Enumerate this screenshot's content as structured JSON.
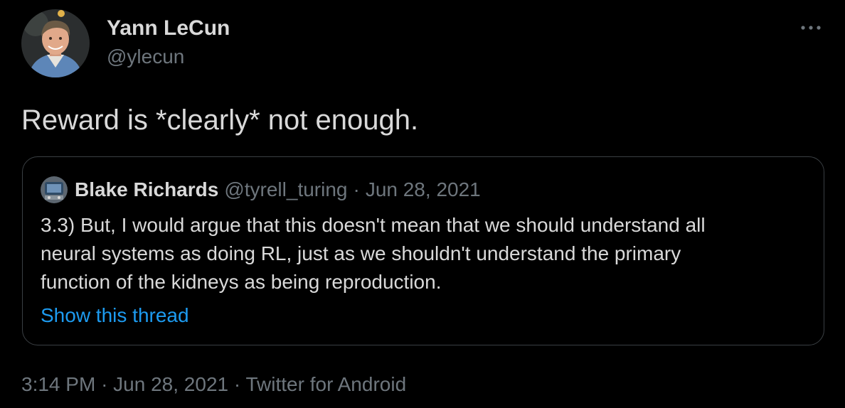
{
  "author": {
    "name": "Yann LeCun",
    "handle": "@ylecun",
    "avatar_icon": "profile-photo-icon"
  },
  "more_icon": "ellipsis-icon",
  "tweet": {
    "text": "Reward is *clearly* not enough."
  },
  "quoted_tweet": {
    "author_name": "Blake Richards",
    "handle": "@tyrell_turing",
    "separator": "·",
    "date": "Jun 28, 2021",
    "avatar_icon": "profile-photo-icon",
    "text_lines": [
      "3.3) But, I would argue that this doesn't mean that we should understand all",
      "neural systems as doing RL, just as we shouldn't understand the primary",
      "function of the kidneys as being reproduction."
    ],
    "show_thread_label": "Show this thread"
  },
  "footer": {
    "time": "3:14 PM",
    "separator": "·",
    "date": "Jun 28, 2021",
    "source": "Twitter for Android"
  },
  "colors": {
    "background": "#000000",
    "primary_text": "#d9d9d9",
    "secondary_text": "#6e767d",
    "link": "#1d9bf0",
    "border": "#3a3f43"
  }
}
